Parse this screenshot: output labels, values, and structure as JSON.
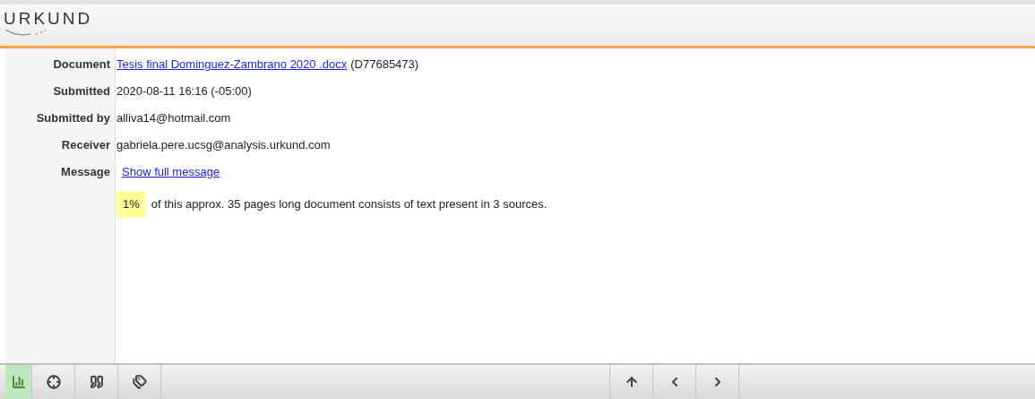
{
  "header": {
    "logo": "URKUND"
  },
  "details": [
    {
      "label": "Document",
      "kind": "document",
      "link": "Tesis final Dominguez-Zambrano 2020 .docx",
      "value": "(D77685473)"
    },
    {
      "label": "Submitted",
      "kind": "text",
      "value": "2020-08-11 16:16 (-05:00)"
    },
    {
      "label": "Submitted by",
      "kind": "text",
      "value": "alliva14@hotmail.com"
    },
    {
      "label": "Receiver",
      "kind": "text",
      "value": "gabriela.pere.ucsg@analysis.urkund.com"
    },
    {
      "label": "Message",
      "kind": "link",
      "link": "Show full message"
    }
  ],
  "summary": {
    "badge": "1%",
    "text": "of this approx. 35 pages long document consists of text present in 3 sources."
  },
  "toolbar": {
    "left": [
      {
        "kind": "chart",
        "selected": true
      },
      {
        "kind": "crosshair",
        "selected": false
      },
      {
        "kind": "quote",
        "selected": false
      },
      {
        "kind": "tags",
        "selected": false
      }
    ],
    "right": [
      {
        "kind": "up"
      },
      {
        "kind": "prev"
      },
      {
        "kind": "next"
      }
    ]
  }
}
